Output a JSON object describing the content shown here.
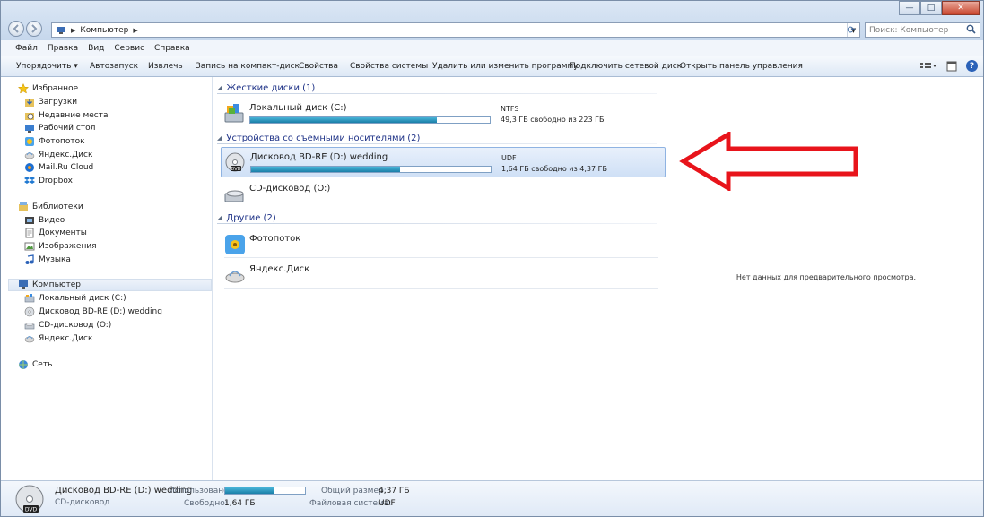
{
  "address": {
    "path": "Компьютер",
    "search_placeholder": "Поиск: Компьютер"
  },
  "window_controls": {
    "minimize": "—",
    "maximize": "□",
    "close": "✕"
  },
  "menu": [
    "Файл",
    "Правка",
    "Вид",
    "Сервис",
    "Справка"
  ],
  "toolbar": [
    "Упорядочить ▾",
    "Автозапуск",
    "Извлечь",
    "Запись на компакт-диск",
    "Свойства",
    "Свойства системы",
    "Удалить или изменить программу",
    "Подключить сетевой диск",
    "Открыть панель управления"
  ],
  "nav": {
    "favorites": "Избранное",
    "favorites_items": [
      "Загрузки",
      "Недавние места",
      "Рабочий стол",
      "Фотопоток",
      "Яндекс.Диск",
      "Mail.Ru Cloud",
      "Dropbox"
    ],
    "libraries": "Библиотеки",
    "libraries_items": [
      "Видео",
      "Документы",
      "Изображения",
      "Музыка"
    ],
    "computer": "Компьютер",
    "computer_items": [
      "Локальный диск (C:)",
      "Дисковод BD-RE (D:) wedding",
      "CD-дисковод (O:)",
      "Яндекс.Диск"
    ],
    "network": "Сеть"
  },
  "groups": {
    "hdd": "Жесткие диски (1)",
    "removable": "Устройства со съемными носителями (2)",
    "other": "Другие (2)"
  },
  "drives": {
    "c": {
      "name": "Локальный диск (C:)",
      "fs": "NTFS",
      "free": "49,3 ГБ свободно из 223 ГБ",
      "used_fraction": 0.78
    },
    "d": {
      "name": "Дисковод BD-RE (D:) wedding",
      "fs": "UDF",
      "free": "1,64 ГБ свободно из 4,37 ГБ",
      "used_fraction": 0.62
    },
    "o": {
      "name": "CD-дисковод (O:)"
    },
    "photostream": {
      "name": "Фотопоток"
    },
    "yandex": {
      "name": "Яндекс.Диск"
    }
  },
  "preview": {
    "empty_text": "Нет данных для предварительного просмотра."
  },
  "details": {
    "name": "Дисковод BD-RE (D:) wedding",
    "type": "CD-дисковод",
    "used_label": "Использовано:",
    "free_label": "Свободно:",
    "free_value": "1,64 ГБ",
    "total_label": "Общий размер:",
    "total_value": "4,37 ГБ",
    "fs_label": "Файловая система:",
    "fs_value": "UDF",
    "used_fraction": 0.62
  },
  "colors": {
    "arrow": "#e8141b",
    "selection": "#cfe0f6",
    "bar": "#1a7fa8"
  }
}
